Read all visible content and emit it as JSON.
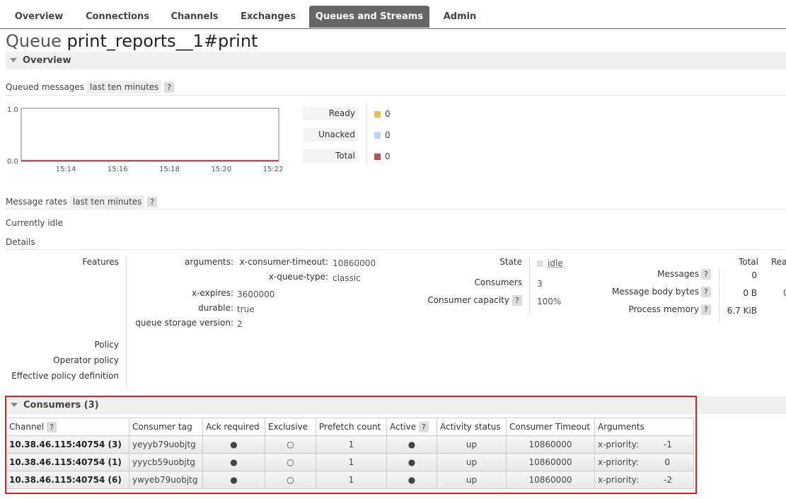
{
  "nav": {
    "tabs": [
      "Overview",
      "Connections",
      "Channels",
      "Exchanges",
      "Queues and Streams",
      "Admin"
    ],
    "active": 4
  },
  "title": {
    "label": "Queue",
    "name": "print_reports__1#print"
  },
  "overview": {
    "heading": "Overview"
  },
  "queued": {
    "label": "Queued messages",
    "range": "last ten minutes",
    "help": "?",
    "chart_data": {
      "type": "line",
      "x": [
        "15:14",
        "15:16",
        "15:18",
        "15:20",
        "15:22"
      ],
      "ylim": [
        0.0,
        1.0
      ],
      "yticks": [
        "1.0",
        "0.0"
      ],
      "series": [
        {
          "name": "Ready",
          "color": "#edc240",
          "values": [
            0,
            0,
            0,
            0,
            0
          ]
        },
        {
          "name": "Unacked",
          "color": "#afd8f8",
          "values": [
            0,
            0,
            0,
            0,
            0
          ]
        },
        {
          "name": "Total",
          "color": "#cb4b4b",
          "values": [
            0,
            0,
            0,
            0,
            0
          ]
        }
      ]
    },
    "legend": [
      {
        "label": "Ready",
        "value": "0",
        "color": "#edc240"
      },
      {
        "label": "Unacked",
        "value": "0",
        "color": "#afd8f8"
      },
      {
        "label": "Total",
        "value": "0",
        "color": "#cb4b4b"
      }
    ]
  },
  "rates": {
    "label": "Message rates",
    "range": "last ten minutes",
    "help": "?",
    "status": "Currently idle"
  },
  "details": {
    "heading": "Details",
    "features_label": "Features",
    "arguments_label": "arguments:",
    "args": [
      {
        "k": "x-consumer-timeout:",
        "v": "10860000"
      },
      {
        "k": "x-queue-type:",
        "v": "classic"
      }
    ],
    "xexpires_k": "x-expires:",
    "xexpires_v": "3600000",
    "durable_k": "durable:",
    "durable_v": "true",
    "qsv_k": "queue storage version:",
    "qsv_v": "2",
    "policy": "Policy",
    "operator_policy": "Operator policy",
    "effective_policy": "Effective policy definition",
    "state_k": "State",
    "state_v": "idle",
    "consumers_k": "Consumers",
    "consumers_v": "3",
    "capacity_k": "Consumer capacity",
    "capacity_v": "100%",
    "help": "?",
    "total_h": "Total",
    "ready_h": "Rea",
    "messages_k": "Messages",
    "messages_v": "0",
    "messages_ready": "0",
    "bytes_k": "Message body bytes",
    "bytes_v": "0 B",
    "bytes_ready": "0",
    "memory_k": "Process memory",
    "memory_v": "6.7 KiB"
  },
  "consumers": {
    "heading": "Consumers (3)",
    "headers": [
      "Channel",
      "Consumer tag",
      "Ack required",
      "Exclusive",
      "Prefetch count",
      "Active",
      "Activity status",
      "Consumer Timeout",
      "Arguments"
    ],
    "help": "?",
    "rows": [
      {
        "channel": "10.38.46.115:40754 (3)",
        "tag": "yeyyb79uobjtg",
        "ack": "●",
        "exclusive": "○",
        "prefetch": "1",
        "active": "●",
        "status": "up",
        "timeout": "10860000",
        "arg_k": "x-priority:",
        "arg_v": "-1"
      },
      {
        "channel": "10.38.46.115:40754 (1)",
        "tag": "yyycb59uobjtg",
        "ack": "●",
        "exclusive": "○",
        "prefetch": "1",
        "active": "●",
        "status": "up",
        "timeout": "10860000",
        "arg_k": "x-priority:",
        "arg_v": "0"
      },
      {
        "channel": "10.38.46.115:40754 (6)",
        "tag": "ywyeb79uobjtg",
        "ack": "●",
        "exclusive": "○",
        "prefetch": "1",
        "active": "●",
        "status": "up",
        "timeout": "10860000",
        "arg_k": "x-priority:",
        "arg_v": "-2"
      }
    ]
  }
}
